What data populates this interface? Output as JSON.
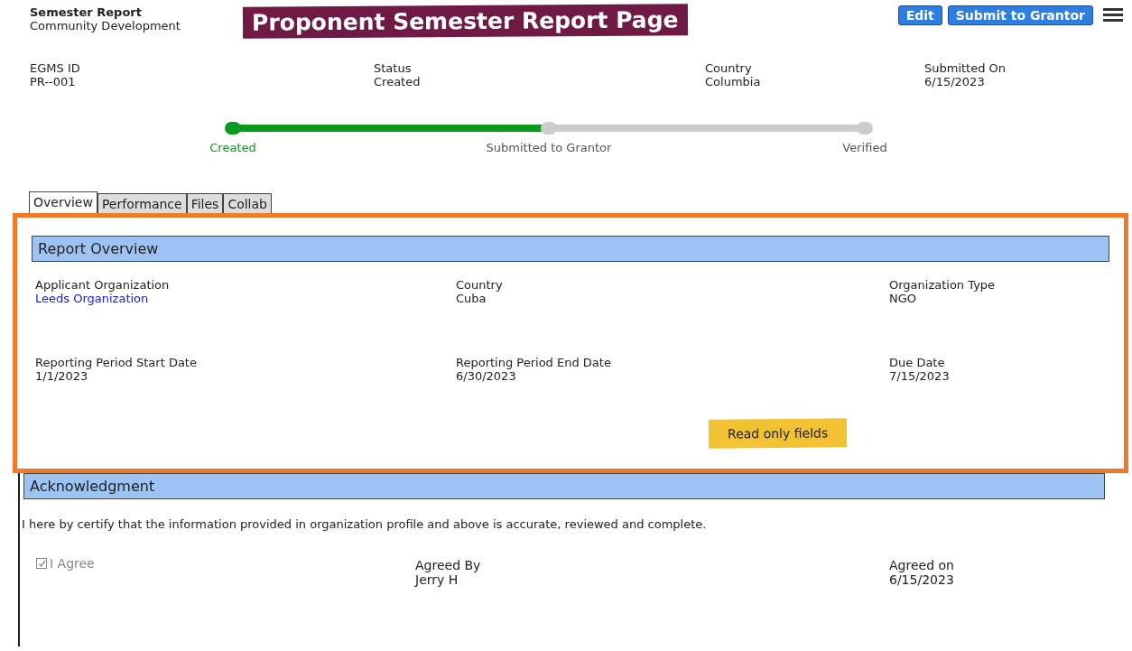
{
  "header": {
    "title": "Semester Report",
    "subtitle": "Community Development"
  },
  "banner": "Proponent Semester Report Page",
  "actions": [
    {
      "label": "Edit"
    },
    {
      "label": "Submit to Grantor"
    }
  ],
  "summary": [
    {
      "label": "EGMS ID",
      "value": "PR--001"
    },
    {
      "label": "Status",
      "value": "Created"
    },
    {
      "label": "Country",
      "value": "Columbia"
    },
    {
      "label": "Submitted On",
      "value": "6/15/2023"
    }
  ],
  "progress": [
    {
      "label": "Created",
      "done": true
    },
    {
      "label": "Submitted to Grantor",
      "done": false
    },
    {
      "label": "Verified",
      "done": false
    }
  ],
  "tabs": [
    {
      "label": "Overview",
      "selected": true
    },
    {
      "label": "Performance",
      "selected": false
    },
    {
      "label": "Files",
      "selected": false
    },
    {
      "label": "Collab",
      "selected": false
    }
  ],
  "overview": {
    "title": "Report Overview",
    "fields": [
      {
        "label": "Applicant Organization",
        "value": "Leeds Organization",
        "kind": "link"
      },
      {
        "label": "Country",
        "value": "Cuba",
        "kind": "text"
      },
      {
        "label": "Organization Type",
        "value": "NGO",
        "kind": "text"
      },
      {
        "label": "Reporting Period Start Date",
        "value": "1/1/2023",
        "kind": "text"
      },
      {
        "label": "Reporting Period End Date",
        "value": "6/30/2023",
        "kind": "text"
      },
      {
        "label": "Due Date",
        "value": "7/15/2023",
        "kind": "text"
      }
    ],
    "note": "Read only fields"
  },
  "acknowledgment": {
    "title": "Acknowledgment",
    "statement": "I here by certify that the information provided in organization profile and above is accurate, reviewed and complete.",
    "agree": {
      "label": "I Agree",
      "checked": true,
      "disabled": true
    },
    "fields": [
      {
        "label": "Agreed By",
        "value": "Jerry H"
      },
      {
        "label": "Agreed on",
        "value": "6/15/2023"
      }
    ]
  }
}
